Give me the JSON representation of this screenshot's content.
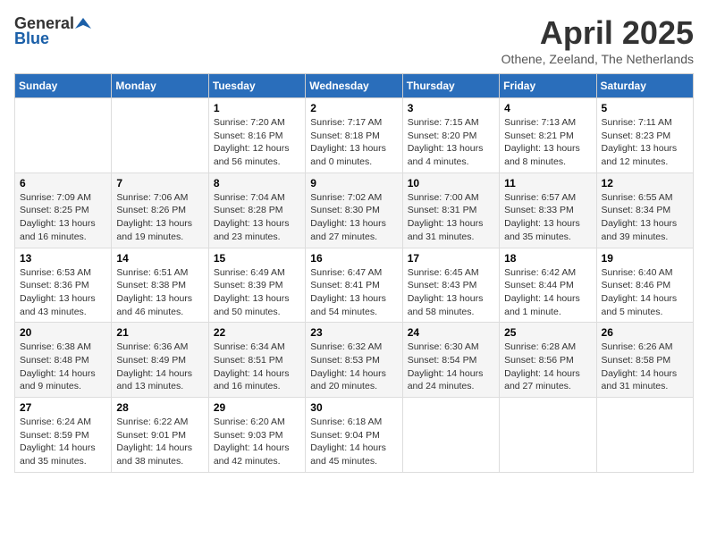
{
  "header": {
    "logo_general": "General",
    "logo_blue": "Blue",
    "month": "April 2025",
    "location": "Othene, Zeeland, The Netherlands"
  },
  "days_of_week": [
    "Sunday",
    "Monday",
    "Tuesday",
    "Wednesday",
    "Thursday",
    "Friday",
    "Saturday"
  ],
  "weeks": [
    [
      {
        "day": "",
        "info": ""
      },
      {
        "day": "",
        "info": ""
      },
      {
        "day": "1",
        "info": "Sunrise: 7:20 AM\nSunset: 8:16 PM\nDaylight: 12 hours\nand 56 minutes."
      },
      {
        "day": "2",
        "info": "Sunrise: 7:17 AM\nSunset: 8:18 PM\nDaylight: 13 hours\nand 0 minutes."
      },
      {
        "day": "3",
        "info": "Sunrise: 7:15 AM\nSunset: 8:20 PM\nDaylight: 13 hours\nand 4 minutes."
      },
      {
        "day": "4",
        "info": "Sunrise: 7:13 AM\nSunset: 8:21 PM\nDaylight: 13 hours\nand 8 minutes."
      },
      {
        "day": "5",
        "info": "Sunrise: 7:11 AM\nSunset: 8:23 PM\nDaylight: 13 hours\nand 12 minutes."
      }
    ],
    [
      {
        "day": "6",
        "info": "Sunrise: 7:09 AM\nSunset: 8:25 PM\nDaylight: 13 hours\nand 16 minutes."
      },
      {
        "day": "7",
        "info": "Sunrise: 7:06 AM\nSunset: 8:26 PM\nDaylight: 13 hours\nand 19 minutes."
      },
      {
        "day": "8",
        "info": "Sunrise: 7:04 AM\nSunset: 8:28 PM\nDaylight: 13 hours\nand 23 minutes."
      },
      {
        "day": "9",
        "info": "Sunrise: 7:02 AM\nSunset: 8:30 PM\nDaylight: 13 hours\nand 27 minutes."
      },
      {
        "day": "10",
        "info": "Sunrise: 7:00 AM\nSunset: 8:31 PM\nDaylight: 13 hours\nand 31 minutes."
      },
      {
        "day": "11",
        "info": "Sunrise: 6:57 AM\nSunset: 8:33 PM\nDaylight: 13 hours\nand 35 minutes."
      },
      {
        "day": "12",
        "info": "Sunrise: 6:55 AM\nSunset: 8:34 PM\nDaylight: 13 hours\nand 39 minutes."
      }
    ],
    [
      {
        "day": "13",
        "info": "Sunrise: 6:53 AM\nSunset: 8:36 PM\nDaylight: 13 hours\nand 43 minutes."
      },
      {
        "day": "14",
        "info": "Sunrise: 6:51 AM\nSunset: 8:38 PM\nDaylight: 13 hours\nand 46 minutes."
      },
      {
        "day": "15",
        "info": "Sunrise: 6:49 AM\nSunset: 8:39 PM\nDaylight: 13 hours\nand 50 minutes."
      },
      {
        "day": "16",
        "info": "Sunrise: 6:47 AM\nSunset: 8:41 PM\nDaylight: 13 hours\nand 54 minutes."
      },
      {
        "day": "17",
        "info": "Sunrise: 6:45 AM\nSunset: 8:43 PM\nDaylight: 13 hours\nand 58 minutes."
      },
      {
        "day": "18",
        "info": "Sunrise: 6:42 AM\nSunset: 8:44 PM\nDaylight: 14 hours\nand 1 minute."
      },
      {
        "day": "19",
        "info": "Sunrise: 6:40 AM\nSunset: 8:46 PM\nDaylight: 14 hours\nand 5 minutes."
      }
    ],
    [
      {
        "day": "20",
        "info": "Sunrise: 6:38 AM\nSunset: 8:48 PM\nDaylight: 14 hours\nand 9 minutes."
      },
      {
        "day": "21",
        "info": "Sunrise: 6:36 AM\nSunset: 8:49 PM\nDaylight: 14 hours\nand 13 minutes."
      },
      {
        "day": "22",
        "info": "Sunrise: 6:34 AM\nSunset: 8:51 PM\nDaylight: 14 hours\nand 16 minutes."
      },
      {
        "day": "23",
        "info": "Sunrise: 6:32 AM\nSunset: 8:53 PM\nDaylight: 14 hours\nand 20 minutes."
      },
      {
        "day": "24",
        "info": "Sunrise: 6:30 AM\nSunset: 8:54 PM\nDaylight: 14 hours\nand 24 minutes."
      },
      {
        "day": "25",
        "info": "Sunrise: 6:28 AM\nSunset: 8:56 PM\nDaylight: 14 hours\nand 27 minutes."
      },
      {
        "day": "26",
        "info": "Sunrise: 6:26 AM\nSunset: 8:58 PM\nDaylight: 14 hours\nand 31 minutes."
      }
    ],
    [
      {
        "day": "27",
        "info": "Sunrise: 6:24 AM\nSunset: 8:59 PM\nDaylight: 14 hours\nand 35 minutes."
      },
      {
        "day": "28",
        "info": "Sunrise: 6:22 AM\nSunset: 9:01 PM\nDaylight: 14 hours\nand 38 minutes."
      },
      {
        "day": "29",
        "info": "Sunrise: 6:20 AM\nSunset: 9:03 PM\nDaylight: 14 hours\nand 42 minutes."
      },
      {
        "day": "30",
        "info": "Sunrise: 6:18 AM\nSunset: 9:04 PM\nDaylight: 14 hours\nand 45 minutes."
      },
      {
        "day": "",
        "info": ""
      },
      {
        "day": "",
        "info": ""
      },
      {
        "day": "",
        "info": ""
      }
    ]
  ]
}
